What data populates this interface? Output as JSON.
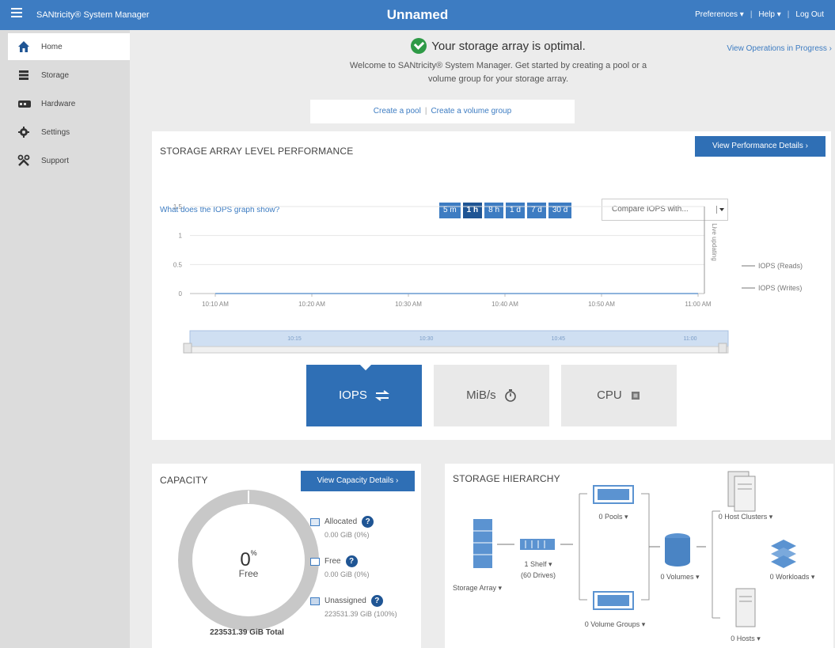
{
  "topbar": {
    "brand": "SANtricity® System Manager",
    "title": "Unnamed",
    "preferences": "Preferences ▾",
    "help": "Help ▾",
    "logout": "Log Out"
  },
  "sidebar": {
    "items": [
      {
        "label": "Home",
        "icon": "home-icon"
      },
      {
        "label": "Storage",
        "icon": "storage-icon"
      },
      {
        "label": "Hardware",
        "icon": "hardware-icon"
      },
      {
        "label": "Settings",
        "icon": "gear-icon"
      },
      {
        "label": "Support",
        "icon": "tools-icon"
      }
    ]
  },
  "status": {
    "headline": "Your storage array is optimal.",
    "welcome_line1": "Welcome to SANtricity® System Manager. Get started by creating a pool or a",
    "welcome_line2": "volume group for your storage array.",
    "view_ops": "View Operations in Progress ›",
    "create_pool": "Create a pool",
    "create_group": "Create a volume group"
  },
  "performance": {
    "title": "STORAGE ARRAY LEVEL PERFORMANCE",
    "details_button": "View Performance Details ›",
    "help_link": "What does the IOPS graph show?",
    "time_buttons": [
      "5 m",
      "1 h",
      "8 h",
      "1 d",
      "7 d",
      "30 d"
    ],
    "selected_time": "1 h",
    "compare": "Compare IOPS with...",
    "metrics": [
      "IOPS",
      "MiB/s",
      "CPU"
    ],
    "active_metric": "IOPS"
  },
  "chart_data": {
    "type": "line",
    "title": "",
    "xlabel": "",
    "ylabel": "",
    "x_ticks": [
      "10:10 AM",
      "10:20 AM",
      "10:30 AM",
      "10:40 AM",
      "10:50 AM",
      "11:00 AM"
    ],
    "y_ticks": [
      "0",
      "0.5",
      "1",
      "1.5"
    ],
    "ylim": [
      0,
      1.5
    ],
    "grid": true,
    "legend_position": "right",
    "series": [
      {
        "name": "IOPS (Reads)",
        "values": [
          0,
          0,
          0,
          0,
          0,
          0
        ]
      },
      {
        "name": "IOPS (Writes)",
        "values": [
          0,
          0,
          0,
          0,
          0,
          0
        ]
      }
    ],
    "annotation": "Live updating",
    "navigator_ticks": [
      "10:15",
      "10:30",
      "10:45",
      "11:00"
    ]
  },
  "capacity": {
    "title": "CAPACITY",
    "details_button": "View Capacity Details ›",
    "percent": "0",
    "percent_sign": "%",
    "free_label": "Free",
    "total": "223531.39 GiB Total",
    "legend": [
      {
        "label": "Allocated",
        "value": "0.00 GiB (0%)"
      },
      {
        "label": "Free",
        "value": "0.00 GiB (0%)"
      },
      {
        "label": "Unassigned",
        "value": "223531.39 GiB (100%)"
      }
    ],
    "colors": {
      "ring": "#c8c8c8",
      "accent": "#3d7cc2"
    }
  },
  "hierarchy": {
    "title": "STORAGE HIERARCHY",
    "storage_array": "Storage Array ▾",
    "shelf": "1 Shelf ▾",
    "drives": "(60 Drives)",
    "pools": "0 Pools ▾",
    "volume_groups": "0 Volume Groups ▾",
    "volumes": "0 Volumes ▾",
    "host_clusters": "0 Host Clusters ▾",
    "workloads": "0 Workloads ▾",
    "hosts": "0 Hosts ▾"
  }
}
